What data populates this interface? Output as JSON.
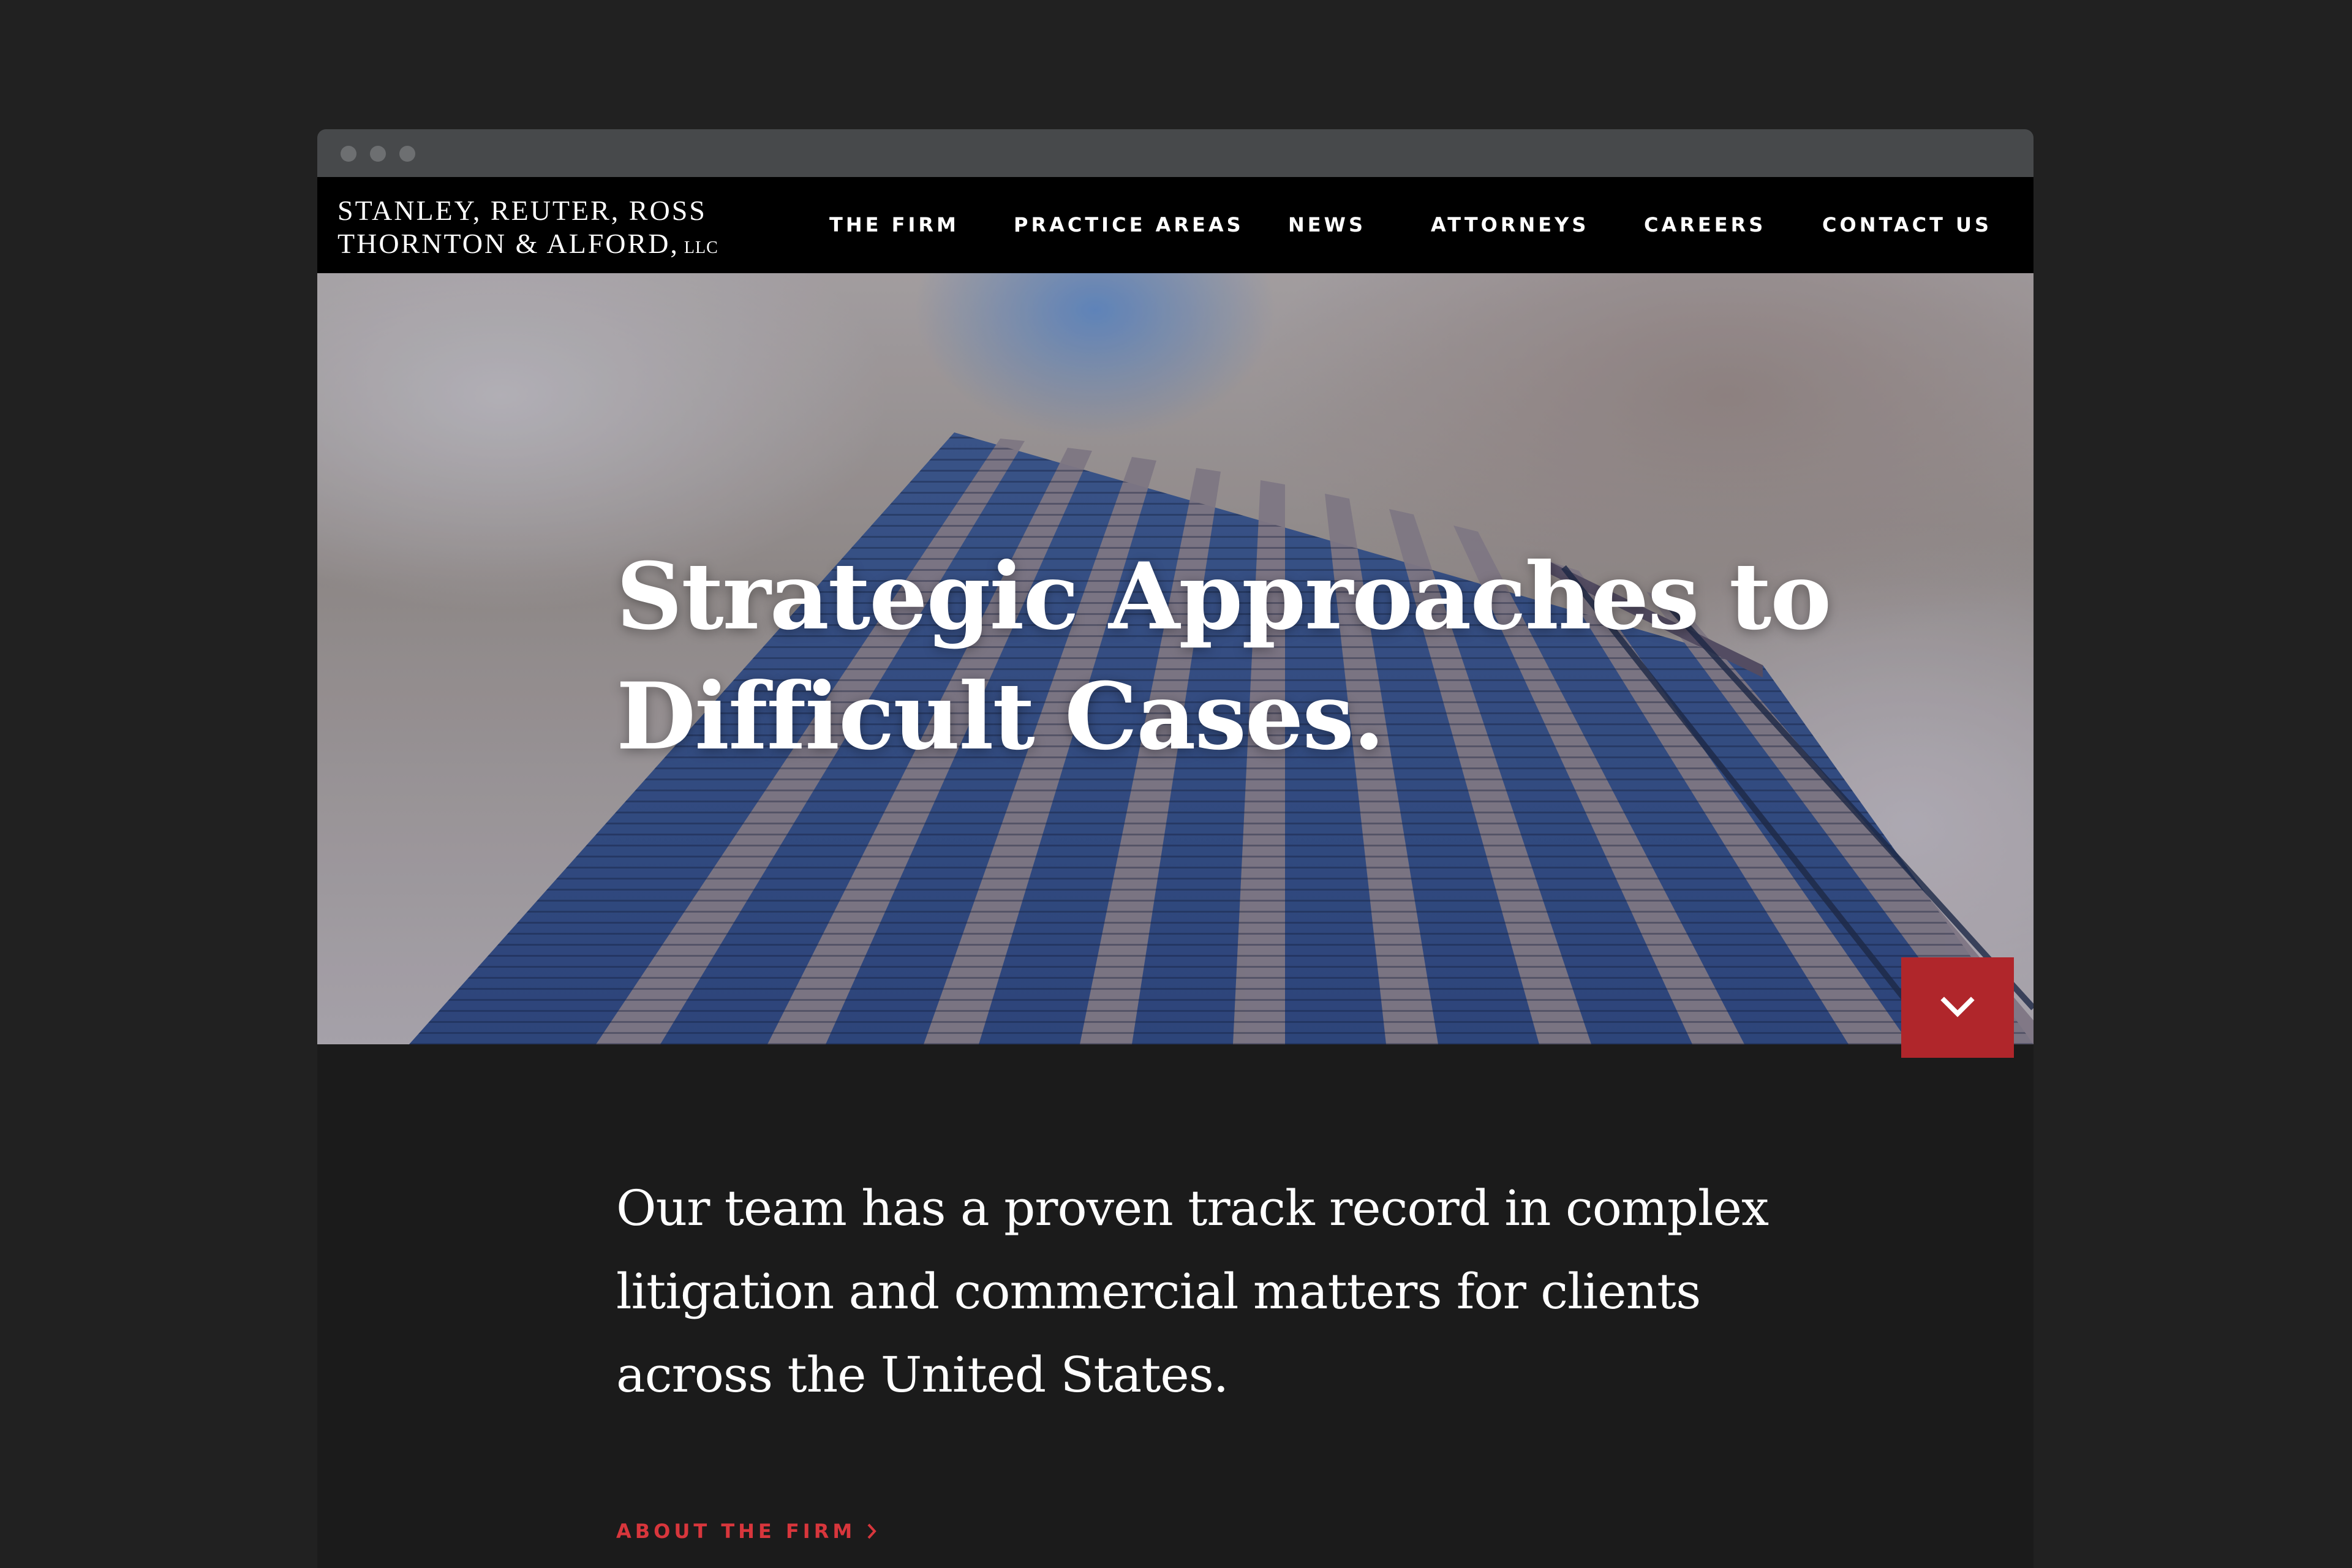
{
  "header": {
    "logo_line1": "STANLEY, REUTER, ROSS",
    "logo_line2": "THORNTON & ALFORD,",
    "logo_suffix": "LLC"
  },
  "nav": {
    "items": [
      {
        "label": "THE FIRM"
      },
      {
        "label": "PRACTICE AREAS"
      },
      {
        "label": "NEWS"
      },
      {
        "label": "ATTORNEYS"
      },
      {
        "label": "CAREERS"
      },
      {
        "label": "CONTACT US"
      }
    ]
  },
  "hero": {
    "title_line1": "Strategic Approaches to",
    "title_line2": "Difficult Cases.",
    "scroll_icon": "chevron-down-icon"
  },
  "intro": {
    "text": "Our team has a proven track record in complex litigation and commercial matters for clients across the United States."
  },
  "about_link": {
    "label": "ABOUT THE FIRM",
    "icon": "chevron-right-icon"
  },
  "colors": {
    "page_background": "#212121",
    "nav_background": "#000000",
    "content_background": "#1b1b1b",
    "accent_red": "#b0262b",
    "link_red": "#d8363c"
  }
}
